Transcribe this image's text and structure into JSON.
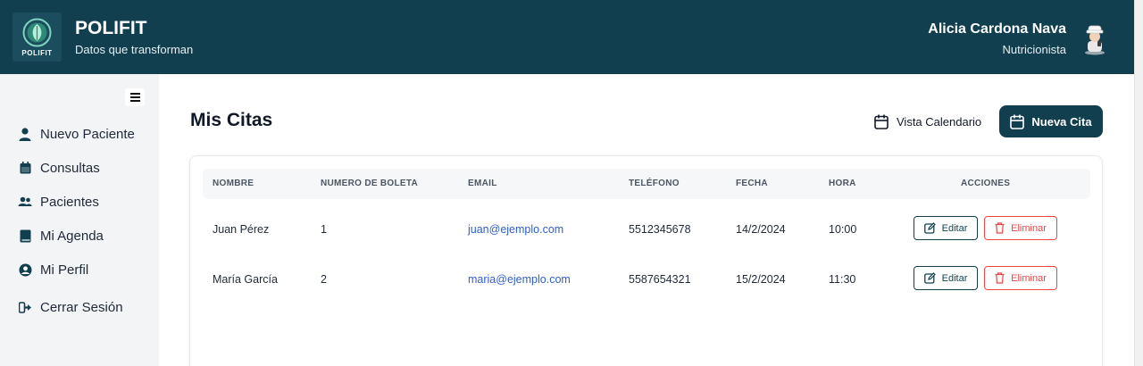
{
  "header": {
    "logo_text": "POLIFIT",
    "brand_title": "POLIFIT",
    "brand_subtitle": "Datos que transforman",
    "user_name": "Alicia Cardona Nava",
    "user_role": "Nutricionista"
  },
  "sidebar": {
    "items": [
      {
        "label": "Nuevo Paciente",
        "icon": "user-icon"
      },
      {
        "label": "Consultas",
        "icon": "calendar-icon"
      },
      {
        "label": "Pacientes",
        "icon": "users-icon"
      },
      {
        "label": "Mi Agenda",
        "icon": "book-icon"
      },
      {
        "label": "Mi Perfil",
        "icon": "profile-circle-icon"
      },
      {
        "label": "Cerrar Sesión",
        "icon": "sign-out-icon"
      }
    ]
  },
  "main": {
    "title": "Mis Citas",
    "calendar_view_label": "Vista Calendario",
    "new_appointment_label": "Nueva Cita"
  },
  "table": {
    "columns": [
      "NOMBRE",
      "NUMERO DE BOLETA",
      "EMAIL",
      "TELÉFONO",
      "FECHA",
      "HORA",
      "ACCIONES"
    ],
    "rows": [
      {
        "nombre": "Juan Pérez",
        "boleta": "1",
        "email": "juan@ejemplo.com",
        "telefono": "5512345678",
        "fecha": "14/2/2024",
        "hora": "10:00"
      },
      {
        "nombre": "María García",
        "boleta": "2",
        "email": "maria@ejemplo.com",
        "telefono": "5587654321",
        "fecha": "15/2/2024",
        "hora": "11:30"
      }
    ],
    "edit_label": "Editar",
    "delete_label": "Eliminar"
  },
  "colors": {
    "primary": "#123f50",
    "danger": "#ef4444",
    "link": "#2f5fd0",
    "sidebar_bg": "#f3f4f6"
  }
}
